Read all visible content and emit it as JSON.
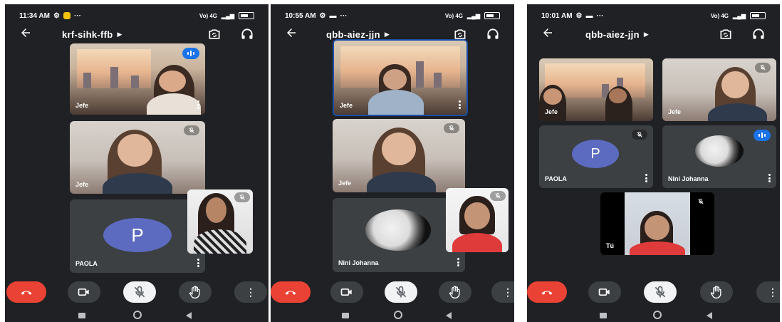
{
  "screens": [
    {
      "status": {
        "time": "11:34 AM",
        "signal": "Vo) 4G",
        "extra": "···"
      },
      "room": "krf-sihk-ffb",
      "tiles": [
        {
          "name": "Jefe"
        },
        {
          "name": "Jefe"
        },
        {
          "name": "PAOLA",
          "initial": "P"
        }
      ]
    },
    {
      "status": {
        "time": "10:55 AM",
        "signal": "Vo) 4G",
        "extra": "···"
      },
      "room": "qbb-aiez-jjn",
      "tiles": [
        {
          "name": "Jefe"
        },
        {
          "name": "Jefe"
        },
        {
          "name": "Nini Johanna"
        }
      ]
    },
    {
      "status": {
        "time": "10:01 AM",
        "signal": "Vo) 4G",
        "extra": "···"
      },
      "room": "qbb-aiez-jjn",
      "tiles": [
        {
          "name": "Jefe"
        },
        {
          "name": "Jefe"
        },
        {
          "name": "PAOLA",
          "initial": "P"
        },
        {
          "name": "Nini Johanna"
        },
        {
          "name": "Tú"
        }
      ]
    }
  ],
  "icons": {
    "back": "arrow-left-icon",
    "room_chevron": "chevron-right-icon",
    "switch_camera": "switch-camera-icon",
    "audio": "headphones-icon",
    "end_call": "end-call-icon",
    "camera": "video-camera-icon",
    "mic": "mic-off-icon",
    "hand": "raise-hand-icon",
    "more": "more-vert-icon"
  },
  "colors": {
    "background": "#202124",
    "tile": "#3c4043",
    "end_call": "#ea4335",
    "speaking": "#1a73e8",
    "avatar": "#5c6bc0"
  }
}
